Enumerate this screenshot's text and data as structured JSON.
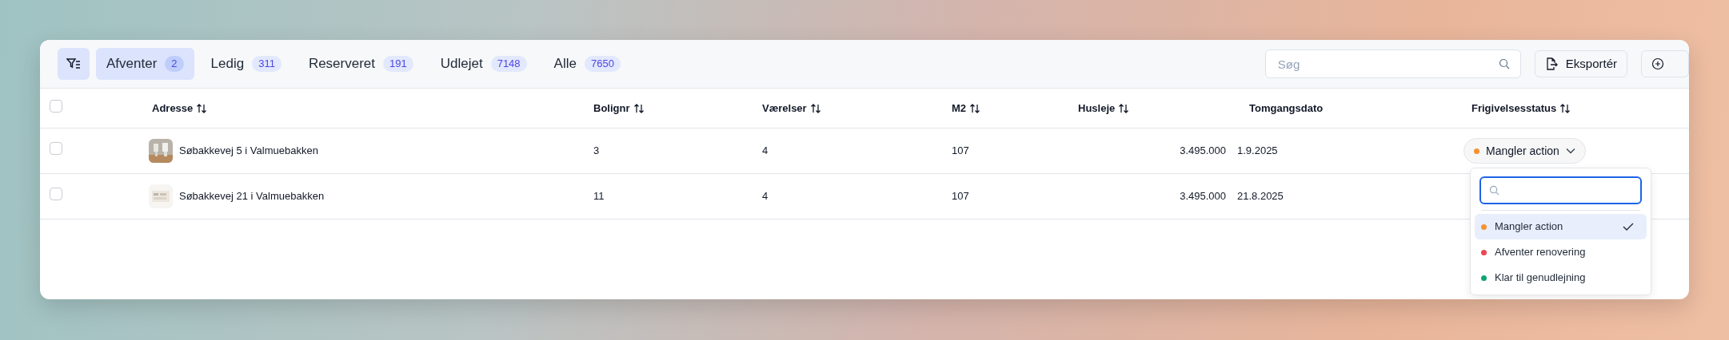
{
  "tabs": [
    {
      "label": "Afventer",
      "count": "2",
      "selected": true
    },
    {
      "label": "Ledig",
      "count": "311",
      "selected": false
    },
    {
      "label": "Reserveret",
      "count": "191",
      "selected": false
    },
    {
      "label": "Udlejet",
      "count": "7148",
      "selected": false
    },
    {
      "label": "Alle",
      "count": "7650",
      "selected": false
    }
  ],
  "search": {
    "placeholder": "Søg"
  },
  "export_button": {
    "label": "Eksportér"
  },
  "table": {
    "select_all_checked": false,
    "columns": [
      {
        "label": "Adresse",
        "sortable": true
      },
      {
        "label": "Bolignr",
        "sortable": true
      },
      {
        "label": "Værelser",
        "sortable": true
      },
      {
        "label": "M2",
        "sortable": true
      },
      {
        "label": "Husleje",
        "sortable": true
      },
      {
        "label": "Tomgangsdato",
        "sortable": false
      },
      {
        "label": "Frigivelsesstatus",
        "sortable": true
      }
    ],
    "rows": [
      {
        "checked": false,
        "address": "Søbakkevej 5 i Valmuebakken",
        "bolignr": "3",
        "vaerelser": "4",
        "m2": "107",
        "husleje": "3.495.000",
        "tomgangsdato": "1.9.2025",
        "status": {
          "label": "Mangler action",
          "color": "#f59331"
        }
      },
      {
        "checked": false,
        "address": "Søbakkevej 21 i Valmuebakken",
        "bolignr": "11",
        "vaerelser": "4",
        "m2": "107",
        "husleje": "3.495.000",
        "tomgangsdato": "21.8.2025"
      }
    ]
  },
  "status_menu": {
    "options": [
      {
        "label": "Mangler action",
        "color": "#f59331",
        "selected": true
      },
      {
        "label": "Afventer renovering",
        "color": "#ef4452",
        "selected": false
      },
      {
        "label": "Klar til genudlejning",
        "color": "#10a56f",
        "selected": false
      }
    ]
  }
}
